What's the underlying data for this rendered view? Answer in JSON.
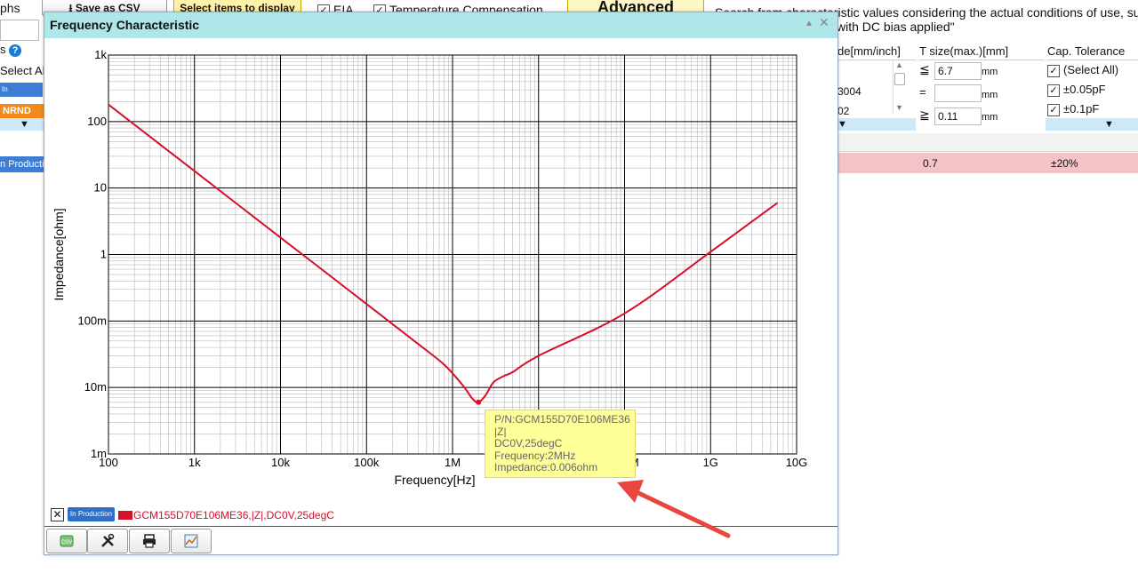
{
  "background": {
    "left_title_fragment": "phs",
    "save_csv_label": "Save as CSV",
    "select_items_label": "Select items to display",
    "eia_label": "EIA",
    "temp_comp_label": "Temperature Compensation",
    "advanced_label": "Advanced",
    "search_note_line1": "Search from characteristic values considering the actual conditions of use, such",
    "search_note_line2": "with DC bias applied\"",
    "left_col_header_fragment": "s",
    "left_select_all": "Select All",
    "left_in_production": "In Production",
    "left_nrnd": "NRND",
    "left_row_status": "n Producti",
    "table": {
      "size_col_header": "de[mm/inch]",
      "size_items": [
        "3004",
        "02"
      ],
      "tsize_header": "T size(max.)[mm]",
      "tsize_le": "≦",
      "tsize_le_value": "6.7",
      "tsize_eq": "=",
      "tsize_eq_value": "",
      "tsize_ge": "≧",
      "tsize_ge_value": "0.11",
      "unit": "mm",
      "cap_tol_header": "Cap. Tolerance",
      "cap_tol_options": [
        "(Select All)",
        "±0.05pF",
        "±0.1pF"
      ],
      "row_tsize": "0.7",
      "row_tolerance": "±20%"
    }
  },
  "dialog": {
    "title": "Frequency Characteristic",
    "minimize_icon": "▲",
    "close_icon": "✕",
    "legend": {
      "remove": "✕",
      "badge": "In Production",
      "label": "GCM155D70E106ME36,|Z|,DC0V,25degC",
      "color": "#d5102c"
    },
    "toolbar": [
      "csv-download-icon",
      "settings-tools-icon",
      "print-icon",
      "chart-image-icon"
    ]
  },
  "tooltip": {
    "line1": "P/N:GCM155D70E106ME36",
    "line2": "|Z|",
    "line3": "DC0V,25degC",
    "line4": "Frequency:2MHz",
    "line5": "Impedance:0.006ohm"
  },
  "chart_data": {
    "type": "line",
    "xlabel": "Frequency[Hz]",
    "ylabel": "Impedance[ohm]",
    "x_scale": "log",
    "y_scale": "log",
    "xlim": [
      100,
      10000000000
    ],
    "ylim": [
      0.001,
      1000
    ],
    "x_ticks": [
      {
        "value": 100,
        "label": "100"
      },
      {
        "value": 1000,
        "label": "1k"
      },
      {
        "value": 10000,
        "label": "10k"
      },
      {
        "value": 100000,
        "label": "100k"
      },
      {
        "value": 1000000,
        "label": "1M"
      },
      {
        "value": 10000000,
        "label": "10M"
      },
      {
        "value": 100000000,
        "label": "100M"
      },
      {
        "value": 1000000000,
        "label": "1G"
      },
      {
        "value": 10000000000,
        "label": "10G"
      }
    ],
    "y_ticks": [
      {
        "value": 0.001,
        "label": "1m"
      },
      {
        "value": 0.01,
        "label": "10m"
      },
      {
        "value": 0.1,
        "label": "100m"
      },
      {
        "value": 1,
        "label": "1"
      },
      {
        "value": 10,
        "label": "10"
      },
      {
        "value": 100,
        "label": "100"
      },
      {
        "value": 1000,
        "label": "1k"
      }
    ],
    "grid": true,
    "series": [
      {
        "name": "GCM155D70E106ME36,|Z|,DC0V,25degC",
        "color": "#d5102c",
        "x": [
          100,
          1000,
          10000,
          100000,
          400000,
          800000,
          1300000,
          1700000,
          2000000,
          2400000,
          3000000,
          4000000,
          5000000,
          10000000,
          100000000,
          1000000000,
          6000000000
        ],
        "y": [
          180,
          18,
          1.8,
          0.18,
          0.045,
          0.022,
          0.011,
          0.0068,
          0.006,
          0.0075,
          0.012,
          0.015,
          0.017,
          0.03,
          0.13,
          1.1,
          6
        ]
      }
    ],
    "highlight_point": {
      "x": 2000000,
      "y": 0.006
    }
  }
}
